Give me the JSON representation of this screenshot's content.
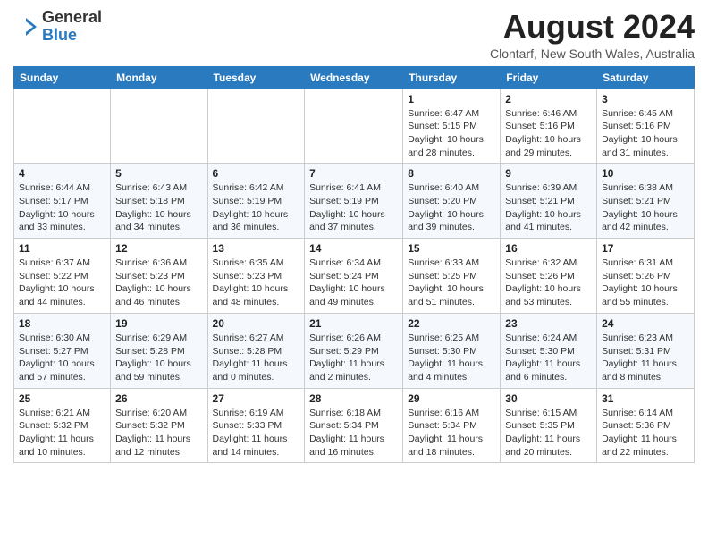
{
  "header": {
    "logo_general": "General",
    "logo_blue": "Blue",
    "month_year": "August 2024",
    "location": "Clontarf, New South Wales, Australia"
  },
  "days_of_week": [
    "Sunday",
    "Monday",
    "Tuesday",
    "Wednesday",
    "Thursday",
    "Friday",
    "Saturday"
  ],
  "weeks": [
    [
      {
        "day": "",
        "info": ""
      },
      {
        "day": "",
        "info": ""
      },
      {
        "day": "",
        "info": ""
      },
      {
        "day": "",
        "info": ""
      },
      {
        "day": "1",
        "info": "Sunrise: 6:47 AM\nSunset: 5:15 PM\nDaylight: 10 hours and 28 minutes."
      },
      {
        "day": "2",
        "info": "Sunrise: 6:46 AM\nSunset: 5:16 PM\nDaylight: 10 hours and 29 minutes."
      },
      {
        "day": "3",
        "info": "Sunrise: 6:45 AM\nSunset: 5:16 PM\nDaylight: 10 hours and 31 minutes."
      }
    ],
    [
      {
        "day": "4",
        "info": "Sunrise: 6:44 AM\nSunset: 5:17 PM\nDaylight: 10 hours and 33 minutes."
      },
      {
        "day": "5",
        "info": "Sunrise: 6:43 AM\nSunset: 5:18 PM\nDaylight: 10 hours and 34 minutes."
      },
      {
        "day": "6",
        "info": "Sunrise: 6:42 AM\nSunset: 5:19 PM\nDaylight: 10 hours and 36 minutes."
      },
      {
        "day": "7",
        "info": "Sunrise: 6:41 AM\nSunset: 5:19 PM\nDaylight: 10 hours and 37 minutes."
      },
      {
        "day": "8",
        "info": "Sunrise: 6:40 AM\nSunset: 5:20 PM\nDaylight: 10 hours and 39 minutes."
      },
      {
        "day": "9",
        "info": "Sunrise: 6:39 AM\nSunset: 5:21 PM\nDaylight: 10 hours and 41 minutes."
      },
      {
        "day": "10",
        "info": "Sunrise: 6:38 AM\nSunset: 5:21 PM\nDaylight: 10 hours and 42 minutes."
      }
    ],
    [
      {
        "day": "11",
        "info": "Sunrise: 6:37 AM\nSunset: 5:22 PM\nDaylight: 10 hours and 44 minutes."
      },
      {
        "day": "12",
        "info": "Sunrise: 6:36 AM\nSunset: 5:23 PM\nDaylight: 10 hours and 46 minutes."
      },
      {
        "day": "13",
        "info": "Sunrise: 6:35 AM\nSunset: 5:23 PM\nDaylight: 10 hours and 48 minutes."
      },
      {
        "day": "14",
        "info": "Sunrise: 6:34 AM\nSunset: 5:24 PM\nDaylight: 10 hours and 49 minutes."
      },
      {
        "day": "15",
        "info": "Sunrise: 6:33 AM\nSunset: 5:25 PM\nDaylight: 10 hours and 51 minutes."
      },
      {
        "day": "16",
        "info": "Sunrise: 6:32 AM\nSunset: 5:26 PM\nDaylight: 10 hours and 53 minutes."
      },
      {
        "day": "17",
        "info": "Sunrise: 6:31 AM\nSunset: 5:26 PM\nDaylight: 10 hours and 55 minutes."
      }
    ],
    [
      {
        "day": "18",
        "info": "Sunrise: 6:30 AM\nSunset: 5:27 PM\nDaylight: 10 hours and 57 minutes."
      },
      {
        "day": "19",
        "info": "Sunrise: 6:29 AM\nSunset: 5:28 PM\nDaylight: 10 hours and 59 minutes."
      },
      {
        "day": "20",
        "info": "Sunrise: 6:27 AM\nSunset: 5:28 PM\nDaylight: 11 hours and 0 minutes."
      },
      {
        "day": "21",
        "info": "Sunrise: 6:26 AM\nSunset: 5:29 PM\nDaylight: 11 hours and 2 minutes."
      },
      {
        "day": "22",
        "info": "Sunrise: 6:25 AM\nSunset: 5:30 PM\nDaylight: 11 hours and 4 minutes."
      },
      {
        "day": "23",
        "info": "Sunrise: 6:24 AM\nSunset: 5:30 PM\nDaylight: 11 hours and 6 minutes."
      },
      {
        "day": "24",
        "info": "Sunrise: 6:23 AM\nSunset: 5:31 PM\nDaylight: 11 hours and 8 minutes."
      }
    ],
    [
      {
        "day": "25",
        "info": "Sunrise: 6:21 AM\nSunset: 5:32 PM\nDaylight: 11 hours and 10 minutes."
      },
      {
        "day": "26",
        "info": "Sunrise: 6:20 AM\nSunset: 5:32 PM\nDaylight: 11 hours and 12 minutes."
      },
      {
        "day": "27",
        "info": "Sunrise: 6:19 AM\nSunset: 5:33 PM\nDaylight: 11 hours and 14 minutes."
      },
      {
        "day": "28",
        "info": "Sunrise: 6:18 AM\nSunset: 5:34 PM\nDaylight: 11 hours and 16 minutes."
      },
      {
        "day": "29",
        "info": "Sunrise: 6:16 AM\nSunset: 5:34 PM\nDaylight: 11 hours and 18 minutes."
      },
      {
        "day": "30",
        "info": "Sunrise: 6:15 AM\nSunset: 5:35 PM\nDaylight: 11 hours and 20 minutes."
      },
      {
        "day": "31",
        "info": "Sunrise: 6:14 AM\nSunset: 5:36 PM\nDaylight: 11 hours and 22 minutes."
      }
    ]
  ]
}
